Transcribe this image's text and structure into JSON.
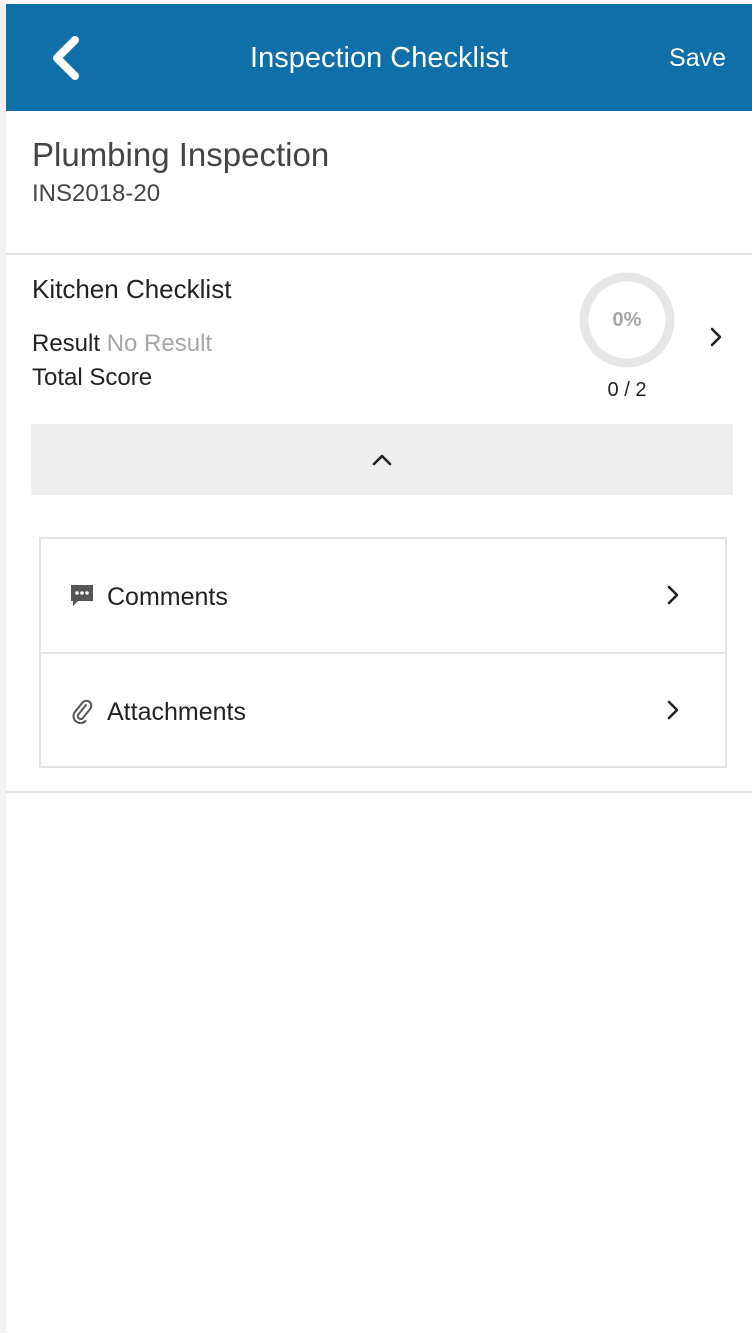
{
  "header": {
    "back_icon": "chevron-left-icon",
    "title": "Inspection Checklist",
    "save_label": "Save",
    "background_color": "#0f6fa8"
  },
  "inspection": {
    "title": "Plumbing Inspection",
    "id": "INS2018-20"
  },
  "checklist": {
    "title": "Kitchen Checklist",
    "result_label": "Result",
    "result_value": "No Result",
    "total_score_label": "Total Score",
    "progress_percent_label": "0%",
    "progress_fraction": 0,
    "progress_count": "0 / 2",
    "chevron_icon": "chevron-right-icon",
    "collapse_icon": "chevron-up-icon"
  },
  "sub_items": [
    {
      "label": "Comments",
      "icon": "comment-icon",
      "chevron_icon": "chevron-right-icon"
    },
    {
      "label": "Attachments",
      "icon": "paperclip-icon",
      "chevron_icon": "chevron-right-icon"
    }
  ]
}
